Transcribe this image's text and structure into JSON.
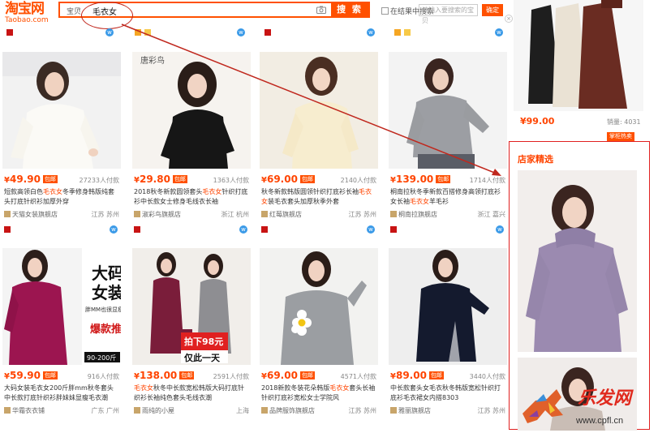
{
  "header": {
    "logo_cn": "淘宝网",
    "logo_en": "Taobao.com",
    "search_scope": "宝贝",
    "search_query": "毛衣女",
    "search_button": "搜 索",
    "within_results": "在结果中搜索",
    "price_placeholder": "请输入要搜索的宝贝",
    "confirm_button": "确定"
  },
  "products": [
    {
      "price": "49.90",
      "sales": "27233人付款",
      "title_pre": "短款高领白色",
      "title_hl": "毛衣女",
      "title_post": "冬季修身韩版纯套头打底针织衫加厚外穿",
      "shop": "天猫女装旗舰店",
      "location": "江苏 苏州"
    },
    {
      "price": "29.80",
      "sales": "1363人付款",
      "title_pre": "2018秋冬新款圆领套头",
      "title_hl": "毛衣女",
      "title_post": "针织打底衫中长款女士修身毛线衣长袖",
      "shop": "淑彩鸟旗舰店",
      "location": "浙江 杭州"
    },
    {
      "price": "69.00",
      "sales": "2140人付款",
      "title_pre": "秋冬新款韩版圆领针织打底衫长袖",
      "title_hl": "毛衣女",
      "title_post": "装毛衣套头加厚秋季外套",
      "shop": "红莓旗舰店",
      "location": "江苏 苏州"
    },
    {
      "price": "139.00",
      "sales": "1714人付款",
      "title_pre": "桐南拉秋冬季新款百搭修身高领打底衫女长袖",
      "title_hl": "毛衣女",
      "title_post": "羊毛衫",
      "shop": "桐南拉旗舰店",
      "location": "浙江 嘉兴"
    },
    {
      "price": "59.90",
      "sales": "916人付款",
      "title_pre": "大码女装毛衣女200斤胖mm秋冬套头中长款打底针织衫胖妹妹显瘦毛衣潮",
      "title_hl": "",
      "title_post": "",
      "shop": "华霜衣衣铺",
      "location": "广东 广州"
    },
    {
      "price": "138.00",
      "sales": "2591人付款",
      "title_pre": "",
      "title_hl": "毛衣女",
      "title_post": "秋冬中长款宽松韩版大码打底针织衫长袖纯色套头毛线衣潮",
      "shop": "雨纯的小屋",
      "location": "上海"
    },
    {
      "price": "69.00",
      "sales": "4571人付款",
      "title_pre": "2018新款冬装花朵韩版",
      "title_hl": "毛衣女",
      "title_post": "套头长袖针织打底衫宽松女士学院风",
      "shop": "品牌服饰旗舰店",
      "location": "江苏 苏州"
    },
    {
      "price": "89.00",
      "sales": "3440人付款",
      "title_pre": "中长款套头女毛衣秋冬韩版宽松针织打底衫毛衣裙女内搭8303",
      "title_hl": "",
      "title_post": "",
      "shop": "雅丽旗舰店",
      "location": "江苏 苏州"
    }
  ],
  "right_rail": {
    "price": "99.00",
    "sales": "销量: 4031",
    "ad_tag": "掌柜热卖",
    "featured_title": "店家精选"
  },
  "watermark": {
    "brand": "乐发网",
    "url": "www.cpfl.cn"
  },
  "colors": {
    "accent": "#ff5000",
    "price": "#ff4400",
    "annotation": "#c0281e"
  },
  "image_texts": {
    "brand_label": "唐彩鸟",
    "promo_big": "大码女装",
    "promo_side": "胖MM也很显瘦",
    "promo_hot": "爆款推荐",
    "promo_range": "90-200斤",
    "promo_discount": "拍下98元",
    "promo_limited": "仅此一天"
  }
}
